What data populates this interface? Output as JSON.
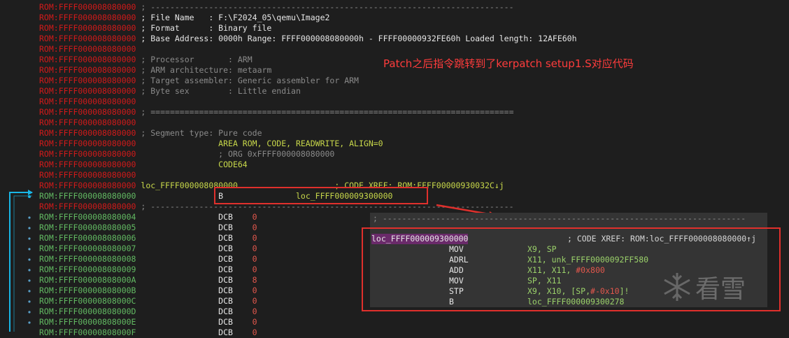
{
  "disasm": {
    "lines": [
      {
        "addr": "ROM:FFFF000008080000",
        "text": " ; ---------------------------------------------------------------------------"
      },
      {
        "addr": "ROM:FFFF000008080000",
        "text": " ; File Name   : F:\\F2024_05\\qemu\\Image2"
      },
      {
        "addr": "ROM:FFFF000008080000",
        "text": " ; Format      : Binary file"
      },
      {
        "addr": "ROM:FFFF000008080000",
        "text": " ; Base Address: 0000h Range: FFFF000008080000h - FFFF00000932FE60h Loaded length: 12AFE60h"
      },
      {
        "addr": "ROM:FFFF000008080000",
        "text": ""
      },
      {
        "addr": "ROM:FFFF000008080000",
        "text": " ; Processor       : ARM"
      },
      {
        "addr": "ROM:FFFF000008080000",
        "text": " ; ARM architecture: metaarm"
      },
      {
        "addr": "ROM:FFFF000008080000",
        "text": " ; Target assembler: Generic assembler for ARM"
      },
      {
        "addr": "ROM:FFFF000008080000",
        "text": " ; Byte sex        : Little endian"
      },
      {
        "addr": "ROM:FFFF000008080000",
        "text": ""
      },
      {
        "addr": "ROM:FFFF000008080000",
        "text": " ; ==========================================================================="
      },
      {
        "addr": "ROM:FFFF000008080000",
        "text": ""
      },
      {
        "addr": "ROM:FFFF000008080000",
        "text": " ; Segment type: Pure code"
      },
      {
        "addr": "ROM:FFFF000008080000",
        "text": "                 AREA ROM, CODE, READWRITE, ALIGN=0"
      },
      {
        "addr": "ROM:FFFF000008080000",
        "text": "                 ; ORG 0xFFFF000008080000"
      },
      {
        "addr": "ROM:FFFF000008080000",
        "text": "                 CODE64"
      },
      {
        "addr": "ROM:FFFF000008080000",
        "text": ""
      },
      {
        "addr": "ROM:FFFF000008080000",
        "text": " loc_FFFF000008080000                    ; CODE XREF: ROM:FFFF00000930032C↓j"
      },
      {
        "addr": "ROM:FFFF000008080000",
        "text": "                 B               loc_FFFF000009300000"
      },
      {
        "addr": "ROM:FFFF000008080000",
        "text": " ; ---------------------------------------------------------------------------"
      },
      {
        "addr": "ROM:FFFF000008080004",
        "text": "                 DCB    0"
      },
      {
        "addr": "ROM:FFFF000008080005",
        "text": "                 DCB    0"
      },
      {
        "addr": "ROM:FFFF000008080006",
        "text": "                 DCB    0"
      },
      {
        "addr": "ROM:FFFF000008080007",
        "text": "                 DCB    0"
      },
      {
        "addr": "ROM:FFFF000008080008",
        "text": "                 DCB    0"
      },
      {
        "addr": "ROM:FFFF000008080009",
        "text": "                 DCB    0"
      },
      {
        "addr": "ROM:FFFF00000808000A",
        "text": "                 DCB    8"
      },
      {
        "addr": "ROM:FFFF00000808000B",
        "text": "                 DCB    0"
      },
      {
        "addr": "ROM:FFFF00000808000C",
        "text": "                 DCB    0"
      },
      {
        "addr": "ROM:FFFF00000808000D",
        "text": "                 DCB    0"
      },
      {
        "addr": "ROM:FFFF00000808000E",
        "text": "                 DCB    0"
      },
      {
        "addr": "ROM:FFFF00000808000F",
        "text": "                 DCB    0"
      }
    ]
  },
  "annotation": "Patch之后指令跳转到了kerpatch setup1.S对应代码",
  "popup": {
    "sep": "; ---------------------------------------------------------------------------",
    "label": "loc_FFFF000009300000",
    "xref": "; CODE XREF: ROM:loc_FFFF000008080000↑j",
    "instrs": [
      {
        "mnem": "MOV",
        "args": "X9, SP"
      },
      {
        "mnem": "ADRL",
        "args": "X11, unk_FFFF0000092FF580"
      },
      {
        "mnem": "ADD",
        "args": "X11, X11, #0x800"
      },
      {
        "mnem": "MOV",
        "args": "SP, X11"
      },
      {
        "mnem": "STP",
        "args": "X9, X10, [SP,#-0x10]!"
      },
      {
        "mnem": "B",
        "args": "loc_FFFF000009300278"
      }
    ]
  },
  "watermark": "看雪",
  "colors": {
    "red_box": "#e0302c",
    "annotation": "#ff3c3c",
    "flow_arrow": "#19b6e6"
  }
}
